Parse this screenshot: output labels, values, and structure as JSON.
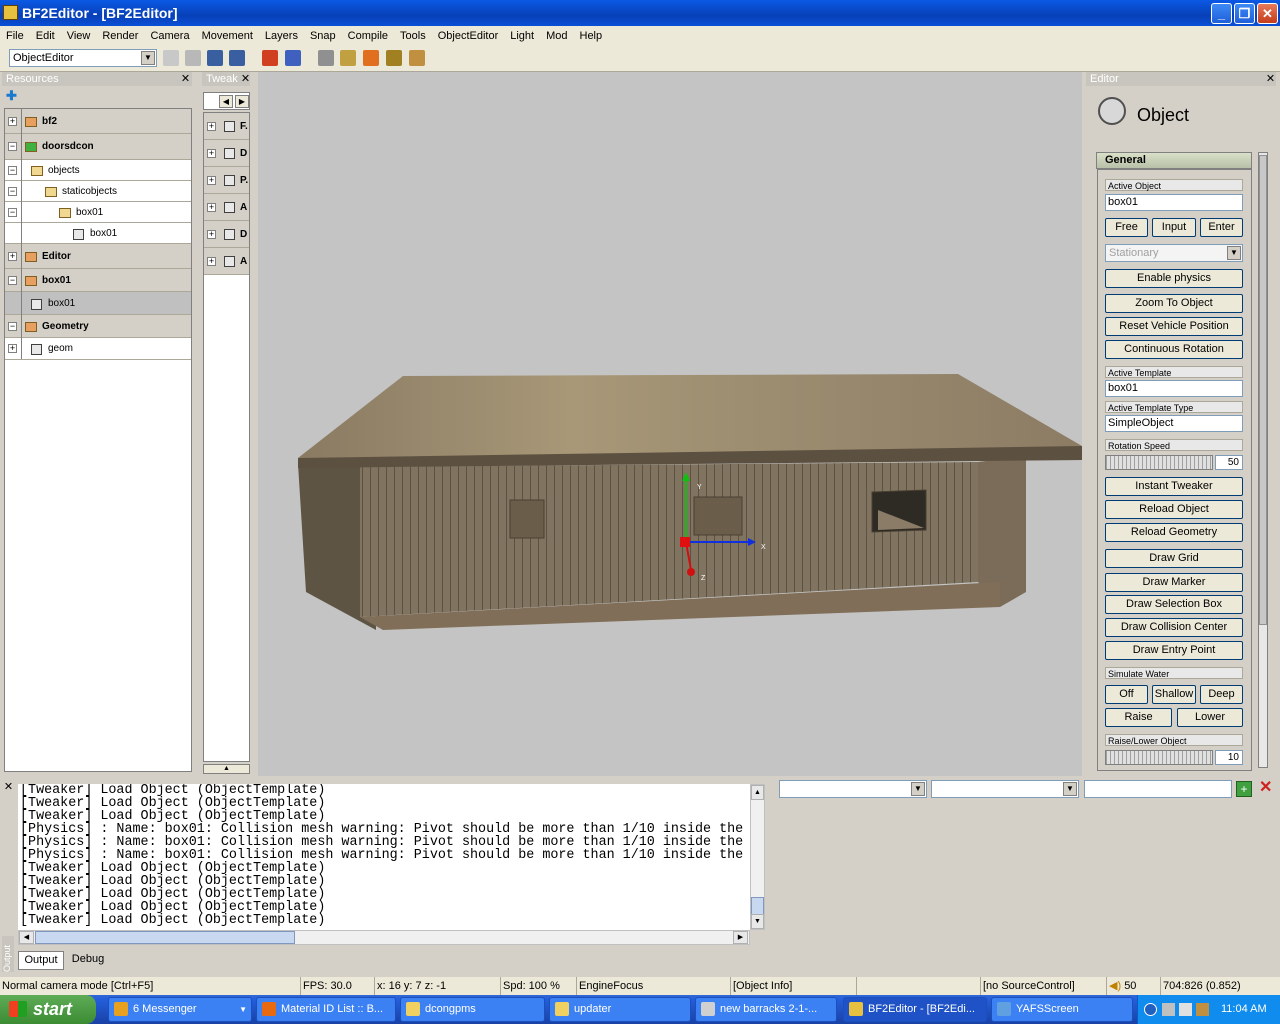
{
  "window": {
    "title": "BF2Editor - [BF2Editor]"
  },
  "menu": [
    "File",
    "Edit",
    "View",
    "Render",
    "Camera",
    "Movement",
    "Layers",
    "Snap",
    "Compile",
    "Tools",
    "ObjectEditor",
    "Light",
    "Mod",
    "Help"
  ],
  "toolbar": {
    "mode_select": "ObjectEditor"
  },
  "resources": {
    "title": "Resources",
    "tree": [
      {
        "label": "bf2",
        "kind": "group",
        "expander": "+"
      },
      {
        "label": "doorsdcon",
        "kind": "group",
        "expander": "-"
      },
      {
        "label": "objects",
        "kind": "folder",
        "expander": "-"
      },
      {
        "label": "staticobjects",
        "kind": "folder",
        "expander": "-"
      },
      {
        "label": "box01",
        "kind": "folder",
        "expander": "-"
      },
      {
        "label": "box01",
        "kind": "object",
        "expander": ""
      },
      {
        "label": "Editor",
        "kind": "group",
        "expander": "+"
      },
      {
        "label": "box01",
        "kind": "group",
        "expander": "-"
      },
      {
        "label": "box01",
        "kind": "selected",
        "expander": ""
      },
      {
        "label": "Geometry",
        "kind": "group",
        "expander": "-"
      },
      {
        "label": "geom",
        "kind": "object",
        "expander": "+"
      }
    ]
  },
  "tweaker": {
    "title": "Tweak",
    "items": [
      "F.",
      "D",
      "P.",
      "A",
      "D",
      "A"
    ]
  },
  "viewport": {
    "gizmo_labels": {
      "y": "Y",
      "x": "X",
      "z": "Z"
    }
  },
  "editor": {
    "title": "Editor",
    "heading": "Object",
    "section": "General",
    "active_object_label": "Active Object",
    "active_object": "box01",
    "mode_buttons": [
      "Free",
      "Input",
      "Enter"
    ],
    "physics_mode": "Stationary",
    "enable_physics": "Enable physics",
    "zoom_to_object": "Zoom To Object",
    "reset_vehicle_position": "Reset Vehicle Position",
    "continuous_rotation": "Continuous Rotation",
    "active_template_label": "Active Template",
    "active_template": "box01",
    "active_template_type_label": "Active Template Type",
    "active_template_type": "SimpleObject",
    "rotation_speed_label": "Rotation Speed",
    "rotation_speed": "50",
    "instant_tweaker": "Instant Tweaker",
    "reload_object": "Reload Object",
    "reload_geometry": "Reload Geometry",
    "draw_grid": "Draw Grid",
    "draw_marker": "Draw Marker",
    "draw_selection_box": "Draw Selection Box",
    "draw_collision_center": "Draw Collision Center",
    "draw_entry_point": "Draw Entry Point",
    "simulate_water_label": "Simulate Water",
    "water_buttons": [
      "Off",
      "Shallow",
      "Deep"
    ],
    "raise": "Raise",
    "lower": "Lower",
    "raise_lower_label": "Raise/Lower Object",
    "raise_lower_value": "10"
  },
  "output": {
    "side_label": "Output",
    "lines": [
      "[Tweaker] Load Object (ObjectTemplate)",
      "[Tweaker] Load Object (ObjectTemplate)",
      "[Tweaker] Load Object (ObjectTemplate)",
      "[Physics] : Name: box01: Collision mesh warning: Pivot should be more than 1/10 inside the",
      "[Physics] : Name: box01: Collision mesh warning: Pivot should be more than 1/10 inside the",
      "[Physics] : Name: box01: Collision mesh warning: Pivot should be more than 1/10 inside the",
      "[Tweaker] Load Object (ObjectTemplate)",
      "[Tweaker] Load Object (ObjectTemplate)",
      "[Tweaker] Load Object (ObjectTemplate)",
      "[Tweaker] Load Object (ObjectTemplate)",
      "[Tweaker] Load Object (ObjectTemplate)"
    ],
    "tabs": [
      "Output",
      "Debug"
    ]
  },
  "status": {
    "camera_mode": "Normal camera mode [Ctrl+F5]",
    "fps": "FPS: 30.0",
    "coords": "x: 16 y: 7 z: -1",
    "speed": "Spd: 100 %",
    "focus": "EngineFocus",
    "object_info": "[Object Info]",
    "source_control": "[no SourceControl]",
    "volume": "50",
    "cursor": "704:826 (0.852)"
  },
  "taskbar": {
    "start": "start",
    "tasks": [
      {
        "label": "6 Messenger",
        "color": "#e8a020"
      },
      {
        "label": "Material ID List :: B...",
        "color": "#e86a10"
      },
      {
        "label": "dcongpms",
        "color": "#f0d060"
      },
      {
        "label": "updater",
        "color": "#f0d060"
      },
      {
        "label": "new barracks 2-1-...",
        "color": "#d0d0d0"
      },
      {
        "label": "BF2Editor - [BF2Edi...",
        "color": "#e8c040"
      },
      {
        "label": "YAFSScreen",
        "color": "#60a0e0"
      }
    ],
    "clock": "11:04 AM"
  }
}
